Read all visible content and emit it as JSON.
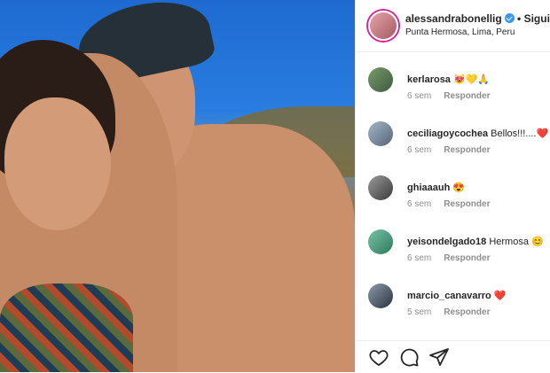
{
  "post": {
    "username": "alessandrabonellig",
    "follow_label": "• Siguiendo",
    "location": "Punta Hermosa, Lima, Peru"
  },
  "comments": [
    {
      "username": "kerlarosa",
      "text": "😻💛🙏",
      "time": "6 sem",
      "reply_label": "Responder"
    },
    {
      "username": "ceciliagoycochea",
      "text": "Bellos!!!....❤️",
      "time": "6 sem",
      "reply_label": "Responder"
    },
    {
      "username": "ghiaaauh",
      "text": "😍",
      "time": "6 sem",
      "reply_label": "Responder"
    },
    {
      "username": "yeisondelgado18",
      "text": "Hermosa 😊",
      "time": "6 sem",
      "reply_label": "Responder"
    },
    {
      "username": "marcio_canavarro",
      "text": "❤️",
      "time": "5 sem",
      "reply_label": "Responder"
    }
  ],
  "icons": {
    "like": "heart-icon",
    "comment": "comment-icon",
    "share": "send-icon"
  },
  "colors": {
    "story_ring": "#d6249f",
    "verified": "#3897f0",
    "heart": "#ed4956"
  }
}
